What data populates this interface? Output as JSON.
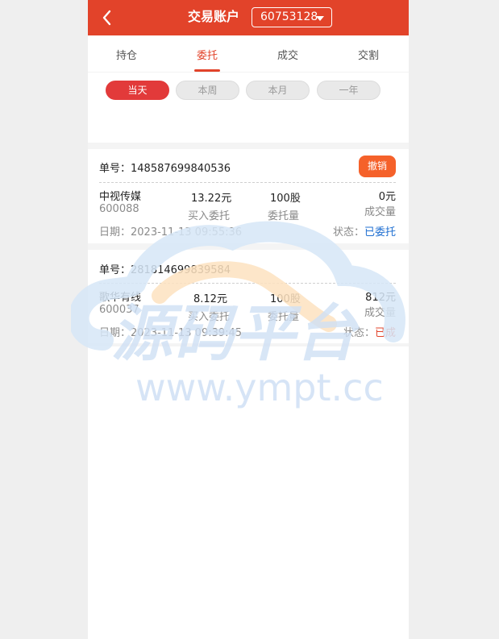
{
  "header": {
    "title": "交易账户",
    "account": "60753128"
  },
  "tabs": [
    {
      "label": "持仓"
    },
    {
      "label": "委托"
    },
    {
      "label": "成交"
    },
    {
      "label": "交割"
    }
  ],
  "periods": [
    {
      "label": "当天"
    },
    {
      "label": "本周"
    },
    {
      "label": "本月"
    },
    {
      "label": "一年"
    }
  ],
  "orders": [
    {
      "order_no": "单号：148587699840536",
      "cancel_label": "撤销",
      "stock_name": "中视传媒",
      "stock_code": "600088",
      "price": "13.22元",
      "side": "买入委托",
      "qty": "100股",
      "qty_label": "委托量",
      "filled": "0元",
      "filled_label": "成交量",
      "date": "日期：2023-11-13 09:55:36",
      "status_label": "状态：",
      "status": "已委托"
    },
    {
      "order_no": "单号：281814699839584",
      "stock_name": "歌华有线",
      "stock_code": "600037",
      "price": "8.12元",
      "side": "买入委托",
      "qty": "100股",
      "qty_label": "委托量",
      "filled": "812元",
      "filled_label": "成交量",
      "date": "日期：2023-11-13 09:39:45",
      "status_label": "状态：",
      "status": "已成"
    }
  ],
  "watermark": {
    "text": "源码平台",
    "url": "www.ympt.cc"
  },
  "colors": {
    "brand": "#e2432a",
    "status_pending": "#1f6fd1",
    "status_done": "#e2432a",
    "cancel": "#f5612a"
  }
}
